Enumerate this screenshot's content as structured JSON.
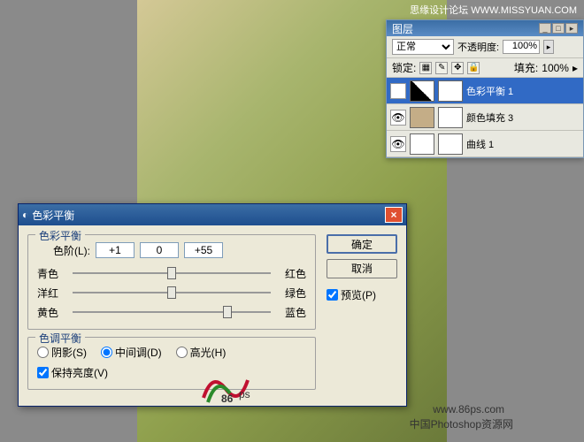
{
  "watermark": {
    "top": "思缘设计论坛  WWW.MISSYUAN.COM",
    "mid": "www.86ps.com",
    "bot": "中国Photoshop资源网",
    "logonum": "86"
  },
  "layers_panel": {
    "title": "图层",
    "blend_mode": "正常",
    "opacity_label": "不透明度:",
    "opacity_value": "100%",
    "lock_label": "锁定:",
    "fill_label": "填充:",
    "fill_value": "100%",
    "items": [
      {
        "name": "色彩平衡 1"
      },
      {
        "name": "颜色填充 3"
      },
      {
        "name": "曲线 1"
      }
    ]
  },
  "dialog": {
    "title": "色彩平衡",
    "ok": "确定",
    "cancel": "取消",
    "preview": "预览(P)",
    "section1": {
      "legend": "色彩平衡",
      "level_label": "色阶(L):",
      "values": [
        "+1",
        "0",
        "+55"
      ],
      "pairs": [
        {
          "left": "青色",
          "right": "红色",
          "pos": 50
        },
        {
          "left": "洋红",
          "right": "绿色",
          "pos": 50
        },
        {
          "left": "黄色",
          "right": "蓝色",
          "pos": 78
        }
      ]
    },
    "section2": {
      "legend": "色调平衡",
      "shadows": "阴影(S)",
      "midtones": "中间调(D)",
      "highlights": "高光(H)",
      "preserve_lum": "保持亮度(V)"
    }
  },
  "chart_data": {
    "type": "table",
    "title": "色彩平衡 / Color Balance adjustment values",
    "rows": [
      {
        "channel": "青色-红色 (Cyan-Red)",
        "value": 1
      },
      {
        "channel": "洋红-绿色 (Magenta-Green)",
        "value": 0
      },
      {
        "channel": "黄色-蓝色 (Yellow-Blue)",
        "value": 55
      }
    ],
    "tone_range": "中间调 (Midtones)",
    "preserve_luminosity": true,
    "value_range": [
      -100,
      100
    ]
  }
}
